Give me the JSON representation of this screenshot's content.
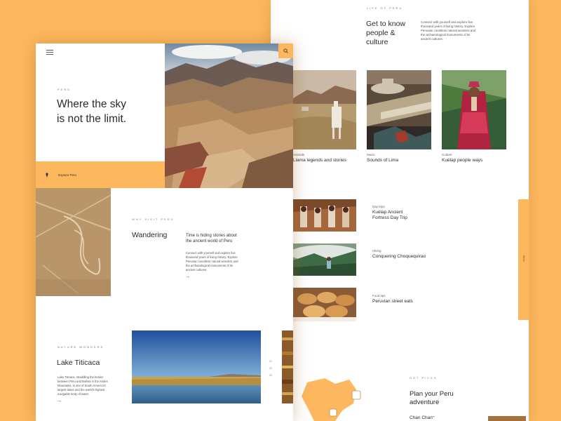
{
  "back": {
    "kicker": "LIFE OF PERU",
    "heading": "Get to know people & culture",
    "intro": "Connect with yourself and explore five thousand years of living history. Explore Peruvian countless natural wonders and the archaeological monuments of its ancient cultures.",
    "cards": [
      {
        "category": "Animals",
        "title": "Llama legends and stories"
      },
      {
        "category": "Music",
        "title": "Sounds of Lima"
      },
      {
        "category": "Culture",
        "title": "Kuélap people ways"
      }
    ],
    "trips": [
      {
        "category": "Day trips",
        "title": "Kuélap Ancient Fortress Day Trip"
      },
      {
        "category": "Hiking",
        "title": "Conquering Choquequirao"
      },
      {
        "category": "Food tips",
        "title": "Peruvian street eats"
      }
    ],
    "side_tab_text": "Menu",
    "hot_picks_kicker": "HOT PICKS",
    "plan_heading": "Plan your Peru adventure",
    "plan_link": "Chan Chan",
    "arrow": "→"
  },
  "front": {
    "menu_icon": "hamburger-icon",
    "search_icon": "search-icon",
    "hero_kicker": "PERU",
    "hero_title": "Where the sky is not the limit.",
    "explore_label": "Explore Peru",
    "explore_icon": "pin-icon",
    "why_kicker": "WHY VISIT PERU",
    "why_heading": "Wandering",
    "why_subheading": "Time is hiding stories about the ancient world of Peru",
    "why_body": "Connect with yourself and explore five thousand years of living history. Explore Peruvian countless natural wonders and the archaeological monuments of its ancient cultures.",
    "nature_kicker": "NATURE WONDERS",
    "nature_heading": "Lake Titicaca",
    "nature_body": "Lake Titicaca, straddling the border between Peru and Bolivia in the Andes Mountains, is one of South America's largest lakes and the world's highest navigable body of water.",
    "pager": [
      "01",
      "02",
      "03"
    ],
    "arrow": "→"
  },
  "colors": {
    "accent": "#fdb85f",
    "text": "#2b2b2b"
  }
}
